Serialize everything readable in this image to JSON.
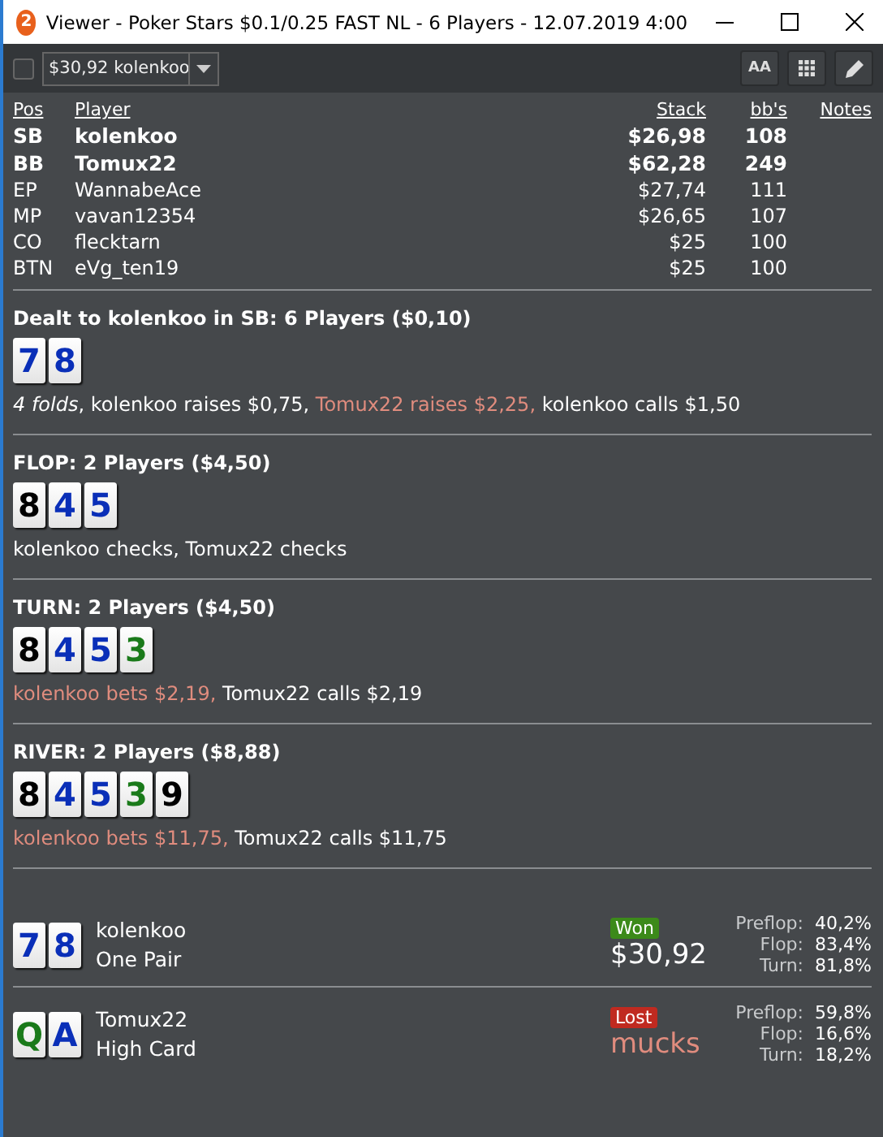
{
  "window": {
    "title": "Viewer - Poker Stars $0.1/0.25 FAST NL - 6 Players - 12.07.2019 4:00",
    "app_badge": "2"
  },
  "toolbar": {
    "checked": false,
    "hand_select": "$30,92 kolenkoo",
    "font_button": "AA"
  },
  "players": {
    "columns": [
      "Pos",
      "Player",
      "Stack",
      "bb's",
      "Notes"
    ],
    "rows": [
      {
        "pos": "SB",
        "name": "kolenkoo",
        "stack": "$26,98",
        "bbs": "108",
        "highlighted": true
      },
      {
        "pos": "BB",
        "name": "Tomux22",
        "stack": "$62,28",
        "bbs": "249",
        "highlighted": true
      },
      {
        "pos": "EP",
        "name": "WannabeAce",
        "stack": "$27,74",
        "bbs": "111",
        "highlighted": false
      },
      {
        "pos": "MP",
        "name": "vavan12354",
        "stack": "$26,65",
        "bbs": "107",
        "highlighted": false
      },
      {
        "pos": "CO",
        "name": "flecktarn",
        "stack": "$25",
        "bbs": "100",
        "highlighted": false
      },
      {
        "pos": "BTN",
        "name": "eVg_ten19",
        "stack": "$25",
        "bbs": "100",
        "highlighted": false
      }
    ]
  },
  "streets": [
    {
      "title": "Dealt to kolenkoo in SB: 6 Players ($0,10)",
      "cards": [
        {
          "rank": "7",
          "color": "#0a2fb8"
        },
        {
          "rank": "8",
          "color": "#0a2fb8"
        }
      ],
      "actions": [
        {
          "text": "*4 folds*,",
          "kind": "passive"
        },
        {
          "text": "kolenkoo raises $0,75,",
          "kind": "passive"
        },
        {
          "text": "Tomux22 raises $2,25,",
          "kind": "aggressive"
        },
        {
          "text": "kolenkoo calls $1,50",
          "kind": "passive"
        }
      ]
    },
    {
      "title": "FLOP: 2 Players ($4,50)",
      "cards": [
        {
          "rank": "8",
          "color": "#000000"
        },
        {
          "rank": "4",
          "color": "#0a2fb8"
        },
        {
          "rank": "5",
          "color": "#0a2fb8"
        }
      ],
      "actions": [
        {
          "text": "kolenkoo checks,",
          "kind": "passive"
        },
        {
          "text": "Tomux22 checks",
          "kind": "passive"
        }
      ]
    },
    {
      "title": "TURN: 2 Players ($4,50)",
      "cards": [
        {
          "rank": "8",
          "color": "#000000"
        },
        {
          "rank": "4",
          "color": "#0a2fb8"
        },
        {
          "rank": "5",
          "color": "#0a2fb8"
        },
        {
          "rank": "3",
          "color": "#1a7a1a"
        }
      ],
      "actions": [
        {
          "text": "kolenkoo bets $2,19,",
          "kind": "aggressive"
        },
        {
          "text": "Tomux22 calls $2,19",
          "kind": "passive"
        }
      ]
    },
    {
      "title": "RIVER: 2 Players ($8,88)",
      "cards": [
        {
          "rank": "8",
          "color": "#000000"
        },
        {
          "rank": "4",
          "color": "#0a2fb8"
        },
        {
          "rank": "5",
          "color": "#0a2fb8"
        },
        {
          "rank": "3",
          "color": "#1a7a1a"
        },
        {
          "rank": "9",
          "color": "#000000"
        }
      ],
      "actions": [
        {
          "text": "kolenkoo bets $11,75,",
          "kind": "aggressive"
        },
        {
          "text": "Tomux22 calls $11,75",
          "kind": "passive"
        }
      ]
    }
  ],
  "results": [
    {
      "cards": [
        {
          "rank": "7",
          "color": "#0a2fb8"
        },
        {
          "rank": "8",
          "color": "#0a2fb8"
        }
      ],
      "name": "kolenkoo",
      "hand": "One Pair",
      "outcome": "Won",
      "kind": "won",
      "amount": "$30,92",
      "equity": [
        {
          "label": "Preflop:",
          "value": "40,2%"
        },
        {
          "label": "Flop:",
          "value": "83,4%"
        },
        {
          "label": "Turn:",
          "value": "81,8%"
        }
      ]
    },
    {
      "cards": [
        {
          "rank": "Q",
          "color": "#1a7a1a"
        },
        {
          "rank": "A",
          "color": "#0a2fb8"
        }
      ],
      "name": "Tomux22",
      "hand": "High Card",
      "outcome": "Lost",
      "kind": "lost",
      "amount": "mucks",
      "equity": [
        {
          "label": "Preflop:",
          "value": "59,8%"
        },
        {
          "label": "Flop:",
          "value": "16,6%"
        },
        {
          "label": "Turn:",
          "value": "18,2%"
        }
      ]
    }
  ]
}
